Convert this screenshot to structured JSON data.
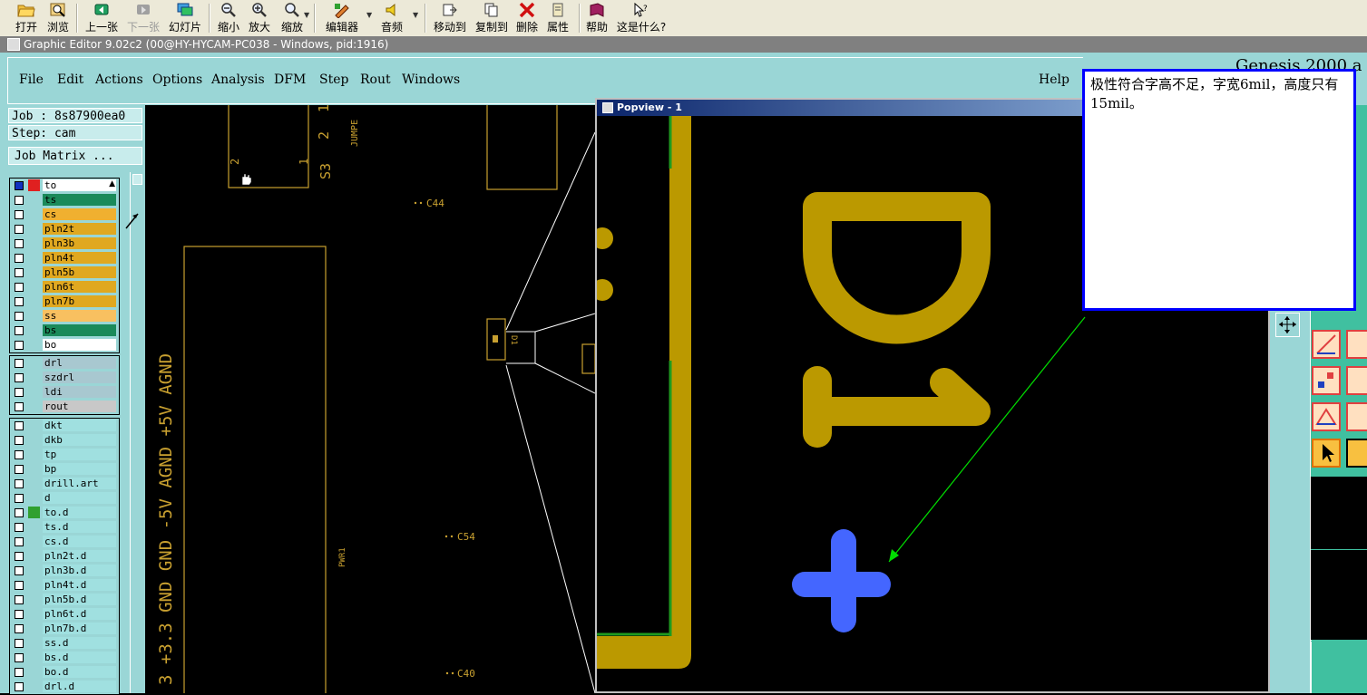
{
  "toolbar": {
    "buttons": [
      {
        "label": "打开",
        "icon": "open-folder-icon"
      },
      {
        "label": "浏览",
        "icon": "browse-icon"
      },
      {
        "label": "上一张",
        "icon": "previous-icon"
      },
      {
        "label": "下一张",
        "icon": "next-icon"
      },
      {
        "label": "幻灯片",
        "icon": "slideshow-icon"
      },
      {
        "label": "缩小",
        "icon": "zoom-out-icon"
      },
      {
        "label": "放大",
        "icon": "zoom-in-icon"
      },
      {
        "label": "缩放",
        "icon": "zoom-icon"
      },
      {
        "label": "编辑器",
        "icon": "editor-icon"
      },
      {
        "label": "音频",
        "icon": "audio-icon"
      },
      {
        "label": "移动到",
        "icon": "move-to-icon"
      },
      {
        "label": "复制到",
        "icon": "copy-to-icon"
      },
      {
        "label": "删除",
        "icon": "delete-icon"
      },
      {
        "label": "属性",
        "icon": "properties-icon"
      },
      {
        "label": "帮助",
        "icon": "help-book-icon"
      },
      {
        "label": "这是什么?",
        "icon": "whats-this-icon"
      }
    ]
  },
  "window": {
    "title": "Graphic Editor 9.02c2 (00@HY-HYCAM-PC038 - Windows, pid:1916)"
  },
  "menu": {
    "items": [
      "File",
      "Edit",
      "Actions",
      "Options",
      "Analysis",
      "DFM",
      "Step",
      "Rout",
      "Windows"
    ],
    "help": "Help",
    "brand_partial": "Genesis 2000 a"
  },
  "job": {
    "job_label": "Job : 8s87900ea0",
    "step_label": "Step: cam",
    "matrix_button": "Job Matrix ..."
  },
  "layers": {
    "group1": [
      {
        "name": "to",
        "color": "#ffffff"
      },
      {
        "name": "ts",
        "color": "#1a8a5a"
      },
      {
        "name": "cs",
        "color": "#f0b030"
      },
      {
        "name": "pln2t",
        "color": "#e0a820"
      },
      {
        "name": "pln3b",
        "color": "#e0a820"
      },
      {
        "name": "pln4t",
        "color": "#e0a820"
      },
      {
        "name": "pln5b",
        "color": "#e0a820"
      },
      {
        "name": "pln6t",
        "color": "#e0a820"
      },
      {
        "name": "pln7b",
        "color": "#e0a820"
      },
      {
        "name": "ss",
        "color": "#f8c060"
      },
      {
        "name": "bs",
        "color": "#1a8a5a"
      },
      {
        "name": "bo",
        "color": "#ffffff"
      }
    ],
    "group2": [
      {
        "name": "drl",
        "color": "#a8c8d0"
      },
      {
        "name": "szdrl",
        "color": "#a8c8d0"
      },
      {
        "name": "ldi",
        "color": "#a8c8d0"
      },
      {
        "name": "rout",
        "color": "#c8c8c8"
      }
    ],
    "group3": [
      {
        "name": "dkt",
        "color": "#a0e0e0"
      },
      {
        "name": "dkb",
        "color": "#a0e0e0"
      },
      {
        "name": "tp",
        "color": "#a0e0e0"
      },
      {
        "name": "bp",
        "color": "#a0e0e0"
      },
      {
        "name": "drill.art",
        "color": "#a0e0e0"
      },
      {
        "name": "d",
        "color": "#a0e0e0"
      },
      {
        "name": "to.d",
        "color": "#a0e0e0"
      },
      {
        "name": "ts.d",
        "color": "#a0e0e0"
      },
      {
        "name": "cs.d",
        "color": "#a0e0e0"
      },
      {
        "name": "pln2t.d",
        "color": "#a0e0e0"
      },
      {
        "name": "pln3b.d",
        "color": "#a0e0e0"
      },
      {
        "name": "pln4t.d",
        "color": "#a0e0e0"
      },
      {
        "name": "pln5b.d",
        "color": "#a0e0e0"
      },
      {
        "name": "pln6t.d",
        "color": "#a0e0e0"
      },
      {
        "name": "pln7b.d",
        "color": "#a0e0e0"
      },
      {
        "name": "ss.d",
        "color": "#a0e0e0"
      },
      {
        "name": "bs.d",
        "color": "#a0e0e0"
      },
      {
        "name": "bo.d",
        "color": "#a0e0e0"
      },
      {
        "name": "drl.d",
        "color": "#a0e0e0"
      }
    ]
  },
  "board": {
    "labels": {
      "jumper": "JUMPE",
      "s3": "S3",
      "pin2": "2",
      "pin1": "1",
      "num2": "2",
      "num1": "1",
      "c44": "C44",
      "c54": "C54",
      "c40": "C40",
      "pwr": "PWR1",
      "rail": "3 +3.3 GND GND -5V AGND +5V AGND",
      "d1_small": "D1"
    },
    "trace_color": "#c8a030"
  },
  "popview": {
    "title": "Popview - 1",
    "silk_text": "D1",
    "silk_color": "#bb9900",
    "pad_color": "#4466ff"
  },
  "note": {
    "text": "极性符合字高不足，字宽6mil，高度只有15mil。"
  }
}
